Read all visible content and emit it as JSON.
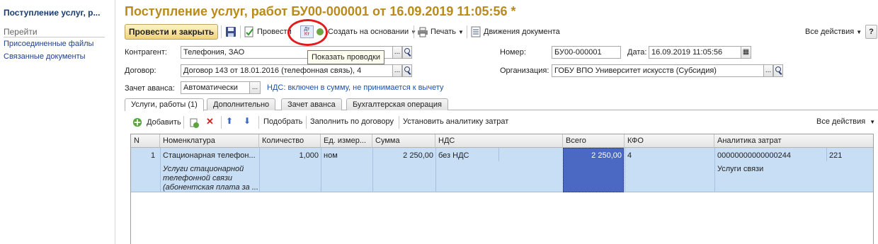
{
  "left_panel": {
    "doc_title": "Поступление услуг, р...",
    "goto_heading": "Перейти",
    "links": [
      "Присоединенные файлы",
      "Связанные документы"
    ]
  },
  "header": {
    "title": "Поступление услуг, работ БУ00-000001 от 16.09.2019 11:05:56 *"
  },
  "toolbar": {
    "post_close": "Провести и закрыть",
    "post": "Провести",
    "dt_kt_top": "Дт",
    "dt_kt_bottom": "Кт",
    "create_based": "Создать на основании",
    "print": "Печать",
    "movements": "Движения документа",
    "all_actions": "Все действия",
    "help": "?"
  },
  "tooltip": "Показать проводки",
  "form": {
    "counterparty_label": "Контрагент:",
    "counterparty_value": "Телефония, ЗАО",
    "contract_label": "Договор:",
    "contract_value": "Договор 143 от 18.01.2016 (телефонная связь), 4",
    "advance_label": "Зачет аванса:",
    "advance_value": "Автоматически",
    "vat_note": "НДС: включен в сумму, не принимается к вычету",
    "number_label": "Номер:",
    "number_value": "БУ00-000001",
    "date_label": "Дата:",
    "date_value": "16.09.2019 11:05:56",
    "org_label": "Организация:",
    "org_value": "ГОБУ ВПО Университет искусств (Субсидия)",
    "dots": "..."
  },
  "tabs": [
    {
      "label": "Услуги, работы (1)",
      "active": true
    },
    {
      "label": "Дополнительно",
      "active": false
    },
    {
      "label": "Зачет аванса",
      "active": false
    },
    {
      "label": "Бухгалтерская операция",
      "active": false
    }
  ],
  "table_toolbar": {
    "add": "Добавить",
    "pick": "Подобрать",
    "fill": "Заполнить по договору",
    "set_analytics": "Установить аналитику затрат",
    "all_actions": "Все действия"
  },
  "table": {
    "headers": [
      "N",
      "Номенклатура",
      "Количество",
      "Ед. измер...",
      "Сумма",
      "НДС",
      "Всего",
      "КФО",
      "Аналитика затрат"
    ],
    "row": {
      "n": "1",
      "item": "Стационарная телефон...",
      "item_desc": [
        "Услуги стационарной",
        "телефонной связи",
        "(абонентская плата за ..."
      ],
      "qty": "1,000",
      "unit": "ном",
      "sum": "2 250,00",
      "vat": "без НДС",
      "total": "2 250,00",
      "kfo": "4",
      "analytics_code": "00000000000000244",
      "analytics_num": "221",
      "analytics_name": "Услуги связи"
    }
  },
  "colors": {
    "title": "#b98a1c",
    "link": "#1f3f8c",
    "selection": "#4b68c2",
    "row": "#c7def5",
    "annotation": "#e01c1c"
  }
}
